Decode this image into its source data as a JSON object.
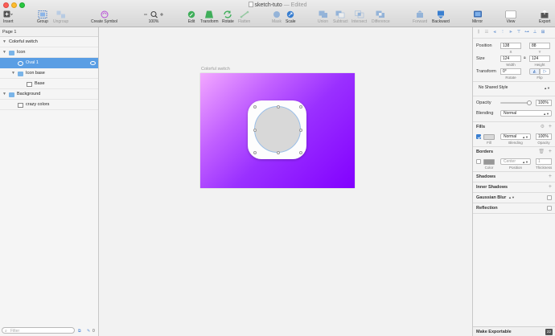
{
  "window": {
    "title": "sketch-tuto",
    "status": "— Edited"
  },
  "toolbar": {
    "insert": "Insert",
    "group": "Group",
    "ungroup": "Ungroup",
    "create_symbol": "Create Symbol",
    "zoom": "100%",
    "edit": "Edit",
    "transform": "Transform",
    "rotate": "Rotate",
    "flatten": "Flatten",
    "mask": "Mask",
    "scale": "Scale",
    "union": "Union",
    "subtract": "Subtract",
    "intersect": "Intersect",
    "difference": "Difference",
    "forward": "Forward",
    "backward": "Backward",
    "mirror": "Mirror",
    "view": "View",
    "export": "Export"
  },
  "layers": {
    "page": "Page 1",
    "items": [
      {
        "label": "Colorful switch",
        "type": "artboard",
        "indent": 0
      },
      {
        "label": "Icon",
        "type": "folder",
        "indent": 0
      },
      {
        "label": "Oval 1",
        "type": "oval",
        "indent": 1,
        "selected": true
      },
      {
        "label": "Icon base",
        "type": "folder",
        "indent": 1
      },
      {
        "label": "Base",
        "type": "rect",
        "indent": 2
      },
      {
        "label": "Background",
        "type": "folder",
        "indent": 0
      },
      {
        "label": "crazy colors",
        "type": "rect",
        "indent": 1
      }
    ],
    "filter_placeholder": "Filter",
    "count": "0"
  },
  "canvas": {
    "artboard_label": "Colorful switch"
  },
  "inspector": {
    "position": {
      "label": "Position",
      "x": "138",
      "y": "88",
      "x_label": "X",
      "y_label": "Y"
    },
    "size": {
      "label": "Size",
      "width": "124",
      "height": "124",
      "w_label": "Width",
      "h_label": "Height"
    },
    "transform": {
      "label": "Transform",
      "rotate": "0°",
      "rotate_label": "Rotate",
      "flip_label": "Flip"
    },
    "shared_style": "No Shared Style",
    "opacity": {
      "label": "Opacity",
      "value": "100%",
      "level": 1.0
    },
    "blending": {
      "label": "Blending",
      "value": "Normal"
    },
    "fills": {
      "title": "Fills",
      "blend": "Normal",
      "opacity": "100%",
      "fill_label": "Fill",
      "blend_label": "Blending",
      "opacity_label": "Opacity",
      "color": "#d8d8d8"
    },
    "borders": {
      "title": "Borders",
      "position": "Center",
      "thickness": "1",
      "color_label": "Color",
      "position_label": "Position",
      "thickness_label": "Thickness",
      "color": "#979797"
    },
    "shadows": "Shadows",
    "inner_shadows": "Inner Shadows",
    "gaussian_blur": "Gaussian Blur",
    "reflection": "Reflection",
    "make_exportable": "Make Exportable",
    "badge": "22"
  },
  "colors": {
    "selection": "#5a9ee4",
    "artboard_start": "#f3a8ff",
    "artboard_end": "#8200ff",
    "accent_blue": "#4a7fc8"
  }
}
